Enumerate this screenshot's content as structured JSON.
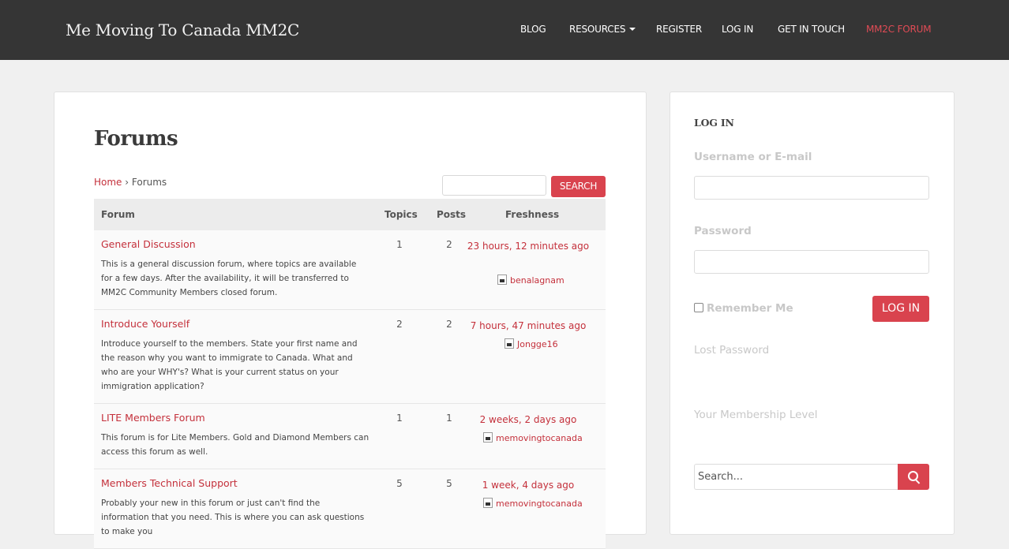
{
  "header": {
    "brand": "Me Moving To Canada MM2C",
    "nav": [
      {
        "label": "BLOG"
      },
      {
        "label": "RESOURCES"
      },
      {
        "label": "REGISTER"
      },
      {
        "label": "LOG IN"
      },
      {
        "label": "GET IN TOUCH"
      },
      {
        "label": "MM2C FORUM"
      }
    ],
    "accent_color": "#e04b55"
  },
  "main": {
    "title": "Forums",
    "breadcrumb": {
      "home": "Home",
      "sep": " › ",
      "current": "Forums"
    },
    "search_button": "SEARCH",
    "table": {
      "headers": {
        "forum": "Forum",
        "topics": "Topics",
        "posts": "Posts",
        "freshness": "Freshness"
      },
      "rows": [
        {
          "title": "General Discussion",
          "description": "This is a general discussion forum, where topics are available for a few days.  After the availability, it will be transferred to MM2C Community Members closed forum.",
          "topics": "1",
          "posts": "2",
          "freshness": "23 hours, 12 minutes ago",
          "author": "benalagnam"
        },
        {
          "title": "Introduce Yourself",
          "description": "Introduce yourself to the members.  State your first name and the reason why you want to immigrate to Canada.  What and who are your WHY's?  What is your current status on your immigration application?",
          "topics": "2",
          "posts": "2",
          "freshness": "7 hours, 47 minutes ago",
          "author": "Jongge16"
        },
        {
          "title": "LITE Members Forum",
          "description": "This forum is for Lite Members.  Gold and Diamond Members can access this forum as well.",
          "topics": "1",
          "posts": "1",
          "freshness": "2 weeks, 2 days ago",
          "author": "memovingtocanada"
        },
        {
          "title": "Members Technical Support",
          "description": "Probably your new in this forum or just can't find the information that you need.  This is where you can ask questions to make you",
          "topics": "5",
          "posts": "5",
          "freshness": "1 week, 4 days ago",
          "author": "memovingtocanada"
        }
      ]
    }
  },
  "sidebar": {
    "heading": "LOG IN",
    "username_label": "Username or E-mail",
    "password_label": "Password",
    "remember_label": "Remember Me",
    "login_button": "LOG IN",
    "lost_password": "Lost Password",
    "membership_level": "Your Membership Level",
    "search_placeholder": "Search...",
    "search_icon": "magnifier-icon"
  }
}
